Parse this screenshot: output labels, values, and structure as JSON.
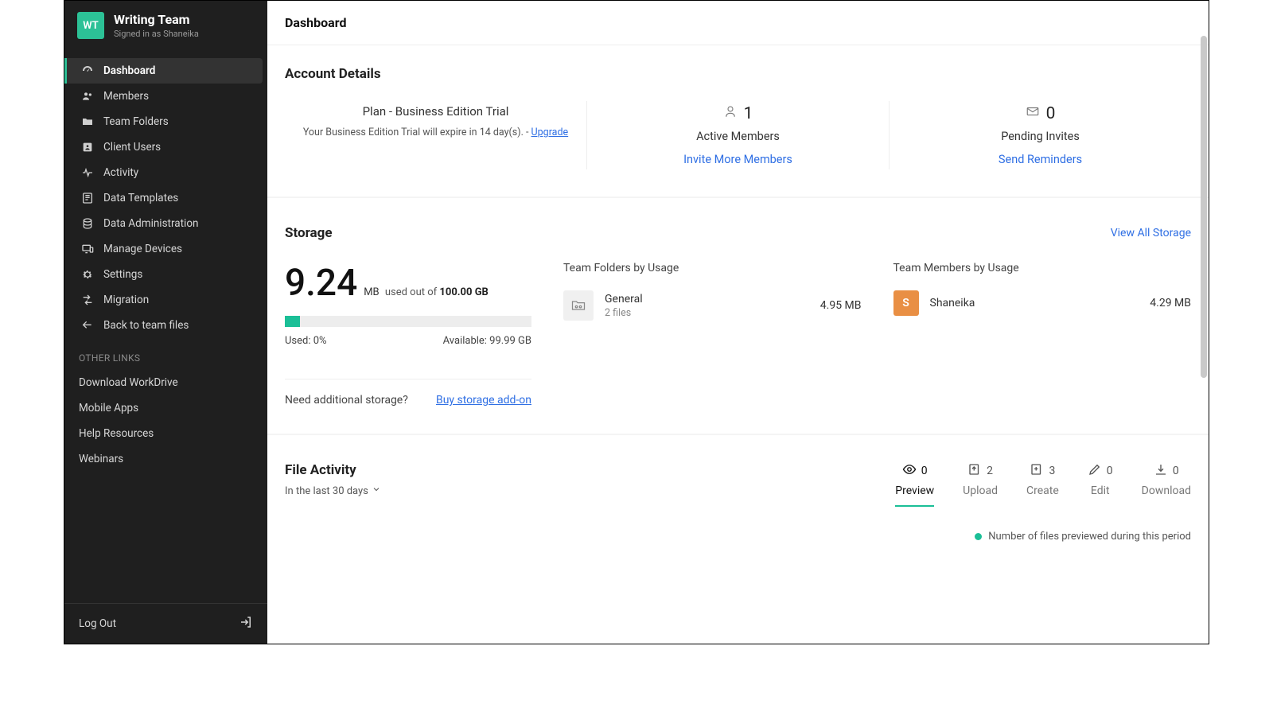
{
  "brand": {
    "badge": "WT",
    "title": "Writing Team",
    "signed_in": "Signed in as Shaneika"
  },
  "nav": {
    "items": [
      {
        "id": "dashboard",
        "label": "Dashboard",
        "active": true
      },
      {
        "id": "members",
        "label": "Members"
      },
      {
        "id": "team-folders",
        "label": "Team Folders"
      },
      {
        "id": "client-users",
        "label": "Client Users"
      },
      {
        "id": "activity",
        "label": "Activity"
      },
      {
        "id": "data-templates",
        "label": "Data Templates"
      },
      {
        "id": "data-admin",
        "label": "Data Administration"
      },
      {
        "id": "manage-devices",
        "label": "Manage Devices"
      },
      {
        "id": "settings",
        "label": "Settings"
      },
      {
        "id": "migration",
        "label": "Migration"
      },
      {
        "id": "back",
        "label": "Back to team files"
      }
    ]
  },
  "other_links": {
    "heading": "OTHER LINKS",
    "items": [
      "Download WorkDrive",
      "Mobile Apps",
      "Help Resources",
      "Webinars"
    ]
  },
  "logout": "Log Out",
  "page": {
    "title": "Dashboard"
  },
  "account": {
    "heading": "Account Details",
    "plan_line": "Plan - Business Edition Trial",
    "expire_text": "Your Business Edition Trial will expire in 14 day(s). - ",
    "upgrade": "Upgrade",
    "active_members_count": "1",
    "active_members_label": "Active Members",
    "invite_link": "Invite More Members",
    "pending_count": "0",
    "pending_label": "Pending Invites",
    "reminders_link": "Send Reminders"
  },
  "storage": {
    "heading": "Storage",
    "view_all": "View All Storage",
    "used_number": "9.24",
    "used_unit": "MB",
    "used_middle": "used out of",
    "total": "100.00 GB",
    "bar_percent": 6,
    "used_label": "Used: 0%",
    "available_label": "Available: 99.99 GB",
    "need_more": "Need additional storage?",
    "buy_link": "Buy storage add-on",
    "folders_title": "Team Folders by Usage",
    "folder_name": "General",
    "folder_sub": "2 files",
    "folder_size": "4.95 MB",
    "members_title": "Team Members by Usage",
    "member_avatar": "S",
    "member_name": "Shaneika",
    "member_size": "4.29 MB"
  },
  "activity": {
    "heading": "File Activity",
    "period": "In the last 30 days",
    "tabs": [
      {
        "id": "preview",
        "count": "0",
        "label": "Preview",
        "active": true
      },
      {
        "id": "upload",
        "count": "2",
        "label": "Upload"
      },
      {
        "id": "create",
        "count": "3",
        "label": "Create"
      },
      {
        "id": "edit",
        "count": "0",
        "label": "Edit"
      },
      {
        "id": "download",
        "count": "0",
        "label": "Download"
      }
    ],
    "legend": "Number of files previewed during this period"
  },
  "colors": {
    "accent": "#1bbf97",
    "link": "#2f6fe4",
    "sidebar_bg": "#1f1f1f"
  }
}
